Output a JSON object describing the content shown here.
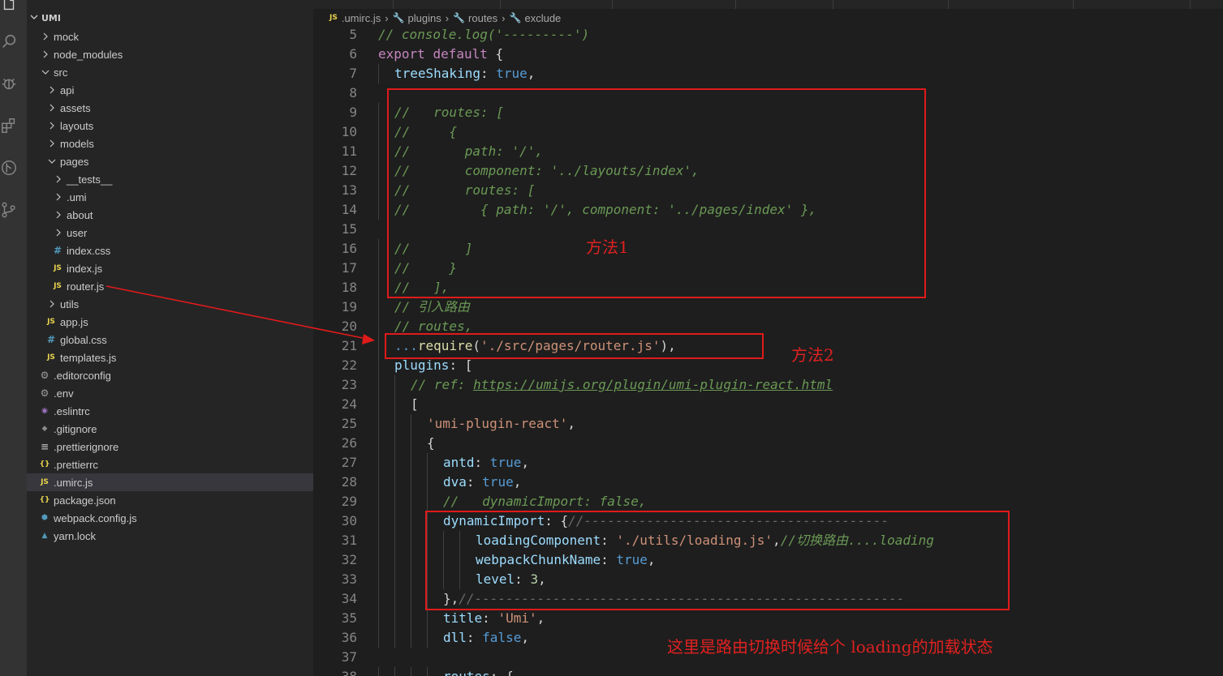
{
  "explorer": {
    "title": "UMI",
    "items": [
      {
        "label": "mock",
        "kind": "folder",
        "depth": 0
      },
      {
        "label": "node_modules",
        "kind": "folder",
        "depth": 0
      },
      {
        "label": "src",
        "kind": "folder-open",
        "depth": 0
      },
      {
        "label": "api",
        "kind": "folder",
        "depth": 1
      },
      {
        "label": "assets",
        "kind": "folder",
        "depth": 1
      },
      {
        "label": "layouts",
        "kind": "folder",
        "depth": 1
      },
      {
        "label": "models",
        "kind": "folder",
        "depth": 1
      },
      {
        "label": "pages",
        "kind": "folder-open",
        "depth": 1
      },
      {
        "label": "__tests__",
        "kind": "folder",
        "depth": 2
      },
      {
        "label": ".umi",
        "kind": "folder",
        "depth": 2
      },
      {
        "label": "about",
        "kind": "folder",
        "depth": 2
      },
      {
        "label": "user",
        "kind": "folder",
        "depth": 2
      },
      {
        "label": "index.css",
        "kind": "css",
        "depth": 2
      },
      {
        "label": "index.js",
        "kind": "js",
        "depth": 2
      },
      {
        "label": "router.js",
        "kind": "js",
        "depth": 2
      },
      {
        "label": "utils",
        "kind": "folder",
        "depth": 1
      },
      {
        "label": "app.js",
        "kind": "js",
        "depth": 1
      },
      {
        "label": "global.css",
        "kind": "css",
        "depth": 1
      },
      {
        "label": "templates.js",
        "kind": "js",
        "depth": 1
      },
      {
        "label": ".editorconfig",
        "kind": "gear",
        "depth": 0
      },
      {
        "label": ".env",
        "kind": "gear",
        "depth": 0
      },
      {
        "label": ".eslintrc",
        "kind": "eslint",
        "depth": 0
      },
      {
        "label": ".gitignore",
        "kind": "git",
        "depth": 0
      },
      {
        "label": ".prettierignore",
        "kind": "lines",
        "depth": 0
      },
      {
        "label": ".prettierrc",
        "kind": "json",
        "depth": 0
      },
      {
        "label": ".umirc.js",
        "kind": "js",
        "depth": 0,
        "selected": true
      },
      {
        "label": "package.json",
        "kind": "json",
        "depth": 0
      },
      {
        "label": "webpack.config.js",
        "kind": "webpack",
        "depth": 0
      },
      {
        "label": "yarn.lock",
        "kind": "yarn",
        "depth": 0
      }
    ]
  },
  "breadcrumb": {
    "file": ".umirc.js",
    "file_icon": "JS",
    "parts": [
      "plugins",
      "routes",
      "exclude"
    ]
  },
  "editor": {
    "lines": [
      {
        "n": "5",
        "indent": 0,
        "tokens": [
          [
            "c",
            "// console.log('---------')"
          ]
        ]
      },
      {
        "n": "6",
        "indent": 0,
        "tokens": [
          [
            "k",
            "export"
          ],
          [
            "t",
            " "
          ],
          [
            "k",
            "default"
          ],
          [
            "t",
            " {"
          ]
        ]
      },
      {
        "n": "7",
        "indent": 1,
        "tokens": [
          [
            "p",
            "treeShaking"
          ],
          [
            "t",
            ": "
          ],
          [
            "b",
            "true"
          ],
          [
            "t",
            ","
          ]
        ]
      },
      {
        "n": "8",
        "indent": 0,
        "tokens": []
      },
      {
        "n": "9",
        "indent": 1,
        "tokens": [
          [
            "c",
            "//   routes: ["
          ]
        ]
      },
      {
        "n": "10",
        "indent": 1,
        "tokens": [
          [
            "c",
            "//     {"
          ]
        ]
      },
      {
        "n": "11",
        "indent": 1,
        "tokens": [
          [
            "c",
            "//       path: '/',"
          ]
        ]
      },
      {
        "n": "12",
        "indent": 1,
        "tokens": [
          [
            "c",
            "//       component: '../layouts/index',"
          ]
        ]
      },
      {
        "n": "13",
        "indent": 1,
        "tokens": [
          [
            "c",
            "//       routes: ["
          ]
        ]
      },
      {
        "n": "14",
        "indent": 1,
        "tokens": [
          [
            "c",
            "//         { path: '/', component: '../pages/index' },"
          ]
        ]
      },
      {
        "n": "15",
        "indent": 0,
        "tokens": []
      },
      {
        "n": "16",
        "indent": 1,
        "tokens": [
          [
            "c",
            "//       ]"
          ]
        ]
      },
      {
        "n": "17",
        "indent": 1,
        "tokens": [
          [
            "c",
            "//     }"
          ]
        ]
      },
      {
        "n": "18",
        "indent": 1,
        "tokens": [
          [
            "c",
            "//   ],"
          ]
        ]
      },
      {
        "n": "19",
        "indent": 1,
        "tokens": [
          [
            "c",
            "// 引入路由"
          ]
        ]
      },
      {
        "n": "20",
        "indent": 1,
        "tokens": [
          [
            "c",
            "// routes,"
          ]
        ]
      },
      {
        "n": "21",
        "indent": 1,
        "tokens": [
          [
            "b",
            "..."
          ],
          [
            "f",
            "require"
          ],
          [
            "t",
            "("
          ],
          [
            "s",
            "'./src/pages/router.js'"
          ],
          [
            "t",
            "),"
          ]
        ]
      },
      {
        "n": "22",
        "indent": 1,
        "tokens": [
          [
            "p",
            "plugins"
          ],
          [
            "t",
            ": ["
          ]
        ]
      },
      {
        "n": "23",
        "indent": 2,
        "tokens": [
          [
            "c",
            "// ref: "
          ],
          [
            "cu",
            "https://umijs.org/plugin/umi-plugin-react.html"
          ]
        ]
      },
      {
        "n": "24",
        "indent": 2,
        "tokens": [
          [
            "t",
            "["
          ]
        ]
      },
      {
        "n": "25",
        "indent": 3,
        "tokens": [
          [
            "s",
            "'umi-plugin-react'"
          ],
          [
            "t",
            ","
          ]
        ]
      },
      {
        "n": "26",
        "indent": 3,
        "tokens": [
          [
            "t",
            "{"
          ]
        ]
      },
      {
        "n": "27",
        "indent": 4,
        "tokens": [
          [
            "p",
            "antd"
          ],
          [
            "t",
            ": "
          ],
          [
            "b",
            "true"
          ],
          [
            "t",
            ","
          ]
        ]
      },
      {
        "n": "28",
        "indent": 4,
        "tokens": [
          [
            "p",
            "dva"
          ],
          [
            "t",
            ": "
          ],
          [
            "b",
            "true"
          ],
          [
            "t",
            ","
          ]
        ]
      },
      {
        "n": "29",
        "indent": 4,
        "tokens": [
          [
            "c",
            "//   dynamicImport: false,"
          ]
        ]
      },
      {
        "n": "30",
        "indent": 4,
        "tokens": [
          [
            "p",
            "dynamicImport"
          ],
          [
            "t",
            ": {"
          ],
          [
            "cg",
            "//---------------------------------------"
          ]
        ]
      },
      {
        "n": "31",
        "indent": 6,
        "tokens": [
          [
            "p",
            "loadingComponent"
          ],
          [
            "t",
            ": "
          ],
          [
            "s",
            "'./utils/loading.js'"
          ],
          [
            "t",
            ","
          ],
          [
            "c",
            "//切换路由....loading"
          ]
        ]
      },
      {
        "n": "32",
        "indent": 6,
        "tokens": [
          [
            "p",
            "webpackChunkName"
          ],
          [
            "t",
            ": "
          ],
          [
            "b",
            "true"
          ],
          [
            "t",
            ","
          ]
        ]
      },
      {
        "n": "33",
        "indent": 6,
        "tokens": [
          [
            "p",
            "level"
          ],
          [
            "t",
            ": "
          ],
          [
            "n",
            "3"
          ],
          [
            "t",
            ","
          ]
        ]
      },
      {
        "n": "34",
        "indent": 4,
        "tokens": [
          [
            "t",
            "},"
          ],
          [
            "cg",
            "//-------------------------------------------------------"
          ]
        ]
      },
      {
        "n": "35",
        "indent": 4,
        "tokens": [
          [
            "p",
            "title"
          ],
          [
            "t",
            ": "
          ],
          [
            "s",
            "'Umi'"
          ],
          [
            "t",
            ","
          ]
        ]
      },
      {
        "n": "36",
        "indent": 4,
        "tokens": [
          [
            "p",
            "dll"
          ],
          [
            "t",
            ": "
          ],
          [
            "b",
            "false"
          ],
          [
            "t",
            ","
          ]
        ]
      },
      {
        "n": "37",
        "indent": 0,
        "tokens": []
      },
      {
        "n": "38",
        "indent": 4,
        "tokens": [
          [
            "p",
            "routes"
          ],
          [
            "t",
            ": {"
          ]
        ]
      }
    ]
  },
  "annotations": {
    "method1": "方法1",
    "method2": "方法2",
    "note": "这里是路由切换时候给个 loading的加载状态"
  },
  "colors": {
    "annotation_red": "#e01a1a",
    "editor_bg": "#1e1e1e",
    "sidebar_bg": "#252526",
    "activity_bg": "#333333"
  }
}
